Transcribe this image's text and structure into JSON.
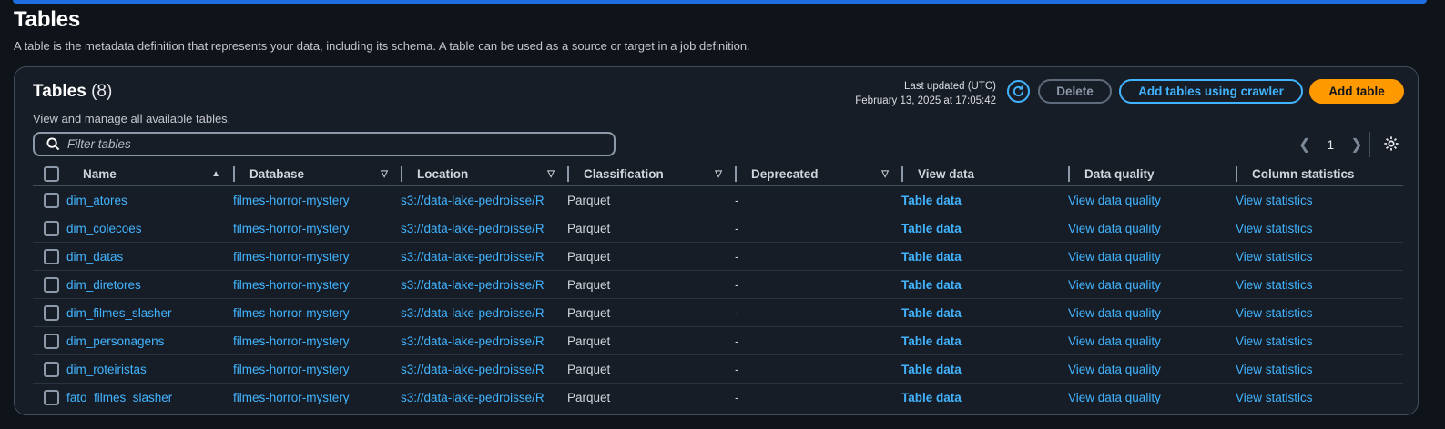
{
  "page": {
    "title": "Tables",
    "description": "A table is the metadata definition that represents your data, including its schema. A table can be used as a source or target in a job definition."
  },
  "panel": {
    "title": "Tables",
    "count": "(8)",
    "subtitle": "View and manage all available tables.",
    "last_updated_label": "Last updated (UTC)",
    "last_updated_value": "February 13, 2025 at 17:05:42",
    "buttons": {
      "delete": "Delete",
      "add_crawler": "Add tables using crawler",
      "add_table": "Add table"
    },
    "filter_placeholder": "Filter tables",
    "pagination": {
      "current_page": "1"
    }
  },
  "columns": [
    "Name",
    "Database",
    "Location",
    "Classification",
    "Deprecated",
    "View data",
    "Data quality",
    "Column statistics"
  ],
  "rows": [
    {
      "name": "dim_atores",
      "database": "filmes-horror-mystery",
      "location": "s3://data-lake-pedroisse/R",
      "classification": "Parquet",
      "deprecated": "-",
      "view_data": "Table data",
      "data_quality": "View data quality",
      "column_statistics": "View statistics"
    },
    {
      "name": "dim_colecoes",
      "database": "filmes-horror-mystery",
      "location": "s3://data-lake-pedroisse/R",
      "classification": "Parquet",
      "deprecated": "-",
      "view_data": "Table data",
      "data_quality": "View data quality",
      "column_statistics": "View statistics"
    },
    {
      "name": "dim_datas",
      "database": "filmes-horror-mystery",
      "location": "s3://data-lake-pedroisse/R",
      "classification": "Parquet",
      "deprecated": "-",
      "view_data": "Table data",
      "data_quality": "View data quality",
      "column_statistics": "View statistics"
    },
    {
      "name": "dim_diretores",
      "database": "filmes-horror-mystery",
      "location": "s3://data-lake-pedroisse/R",
      "classification": "Parquet",
      "deprecated": "-",
      "view_data": "Table data",
      "data_quality": "View data quality",
      "column_statistics": "View statistics"
    },
    {
      "name": "dim_filmes_slasher",
      "database": "filmes-horror-mystery",
      "location": "s3://data-lake-pedroisse/R",
      "classification": "Parquet",
      "deprecated": "-",
      "view_data": "Table data",
      "data_quality": "View data quality",
      "column_statistics": "View statistics"
    },
    {
      "name": "dim_personagens",
      "database": "filmes-horror-mystery",
      "location": "s3://data-lake-pedroisse/R",
      "classification": "Parquet",
      "deprecated": "-",
      "view_data": "Table data",
      "data_quality": "View data quality",
      "column_statistics": "View statistics"
    },
    {
      "name": "dim_roteiristas",
      "database": "filmes-horror-mystery",
      "location": "s3://data-lake-pedroisse/R",
      "classification": "Parquet",
      "deprecated": "-",
      "view_data": "Table data",
      "data_quality": "View data quality",
      "column_statistics": "View statistics"
    },
    {
      "name": "fato_filmes_slasher",
      "database": "filmes-horror-mystery",
      "location": "s3://data-lake-pedroisse/R",
      "classification": "Parquet",
      "deprecated": "-",
      "view_data": "Table data",
      "data_quality": "View data quality",
      "column_statistics": "View statistics"
    }
  ],
  "colors": {
    "background": "#0f141a",
    "panel": "#161d26",
    "link": "#42b4ff",
    "primary_button": "#ff9900",
    "top_banner": "#1d6fe0"
  },
  "icons": {
    "refresh": "refresh-icon",
    "search": "search-icon",
    "settings": "gear-icon",
    "prev": "chevron-left-icon",
    "next": "chevron-right-icon",
    "sort_ascending": "sort-asc-icon",
    "sort_toggle": "sort-toggle-icon"
  }
}
